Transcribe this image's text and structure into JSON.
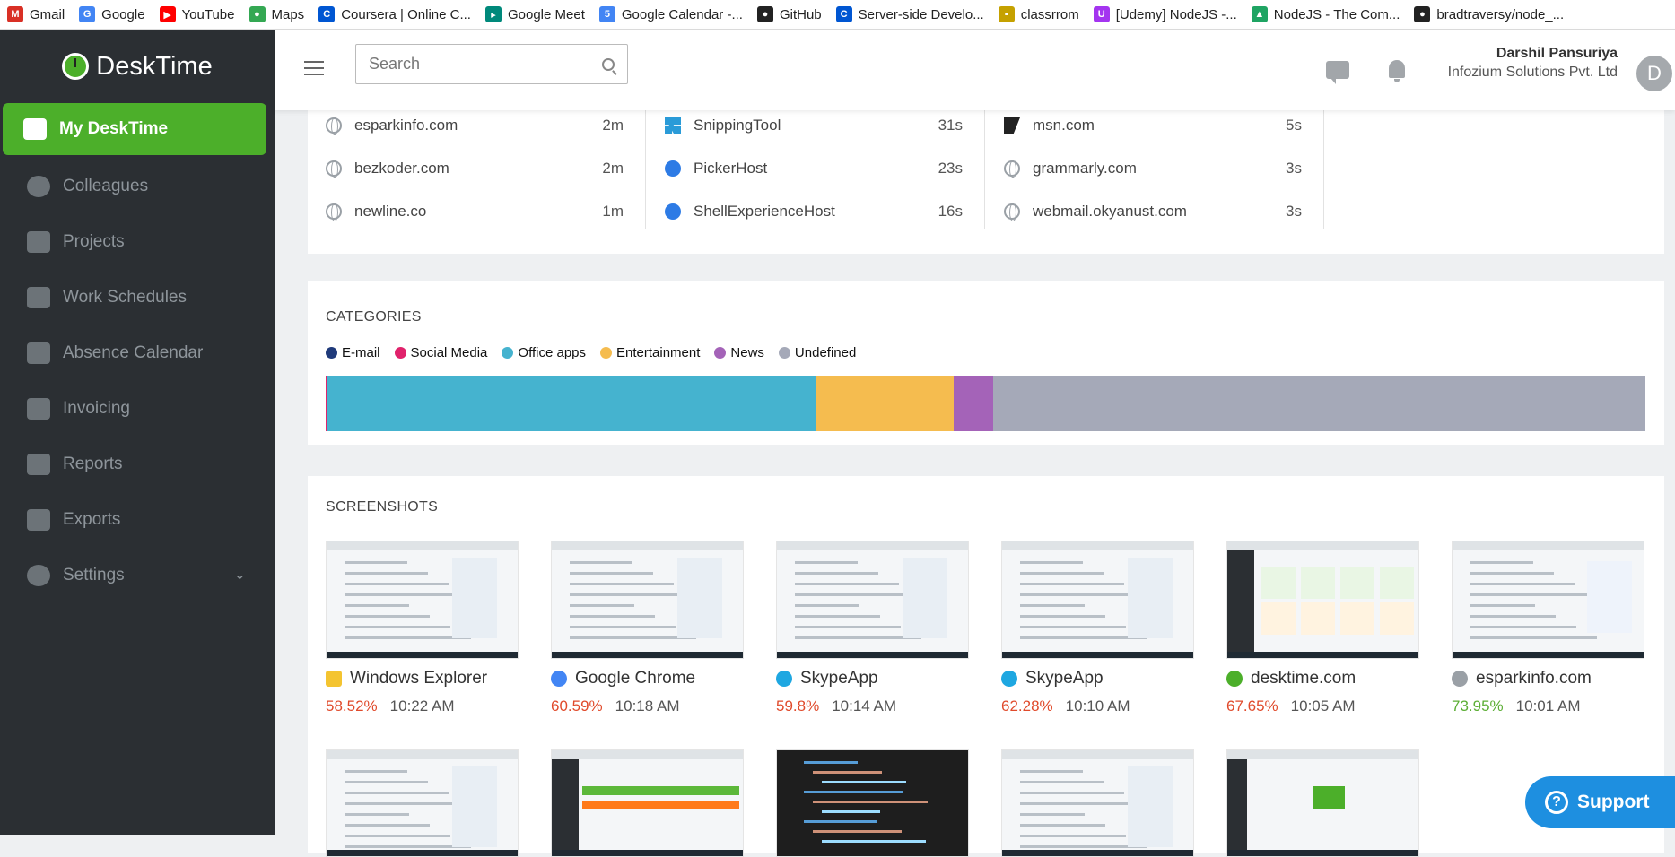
{
  "bookmarks": [
    {
      "label": "Gmail",
      "icon": "gmail-icon",
      "color": "#d93025",
      "glyph": "M"
    },
    {
      "label": "Google",
      "icon": "google-icon",
      "color": "#4285f4",
      "glyph": "G"
    },
    {
      "label": "YouTube",
      "icon": "youtube-icon",
      "color": "#ff0000",
      "glyph": "▶"
    },
    {
      "label": "Maps",
      "icon": "maps-icon",
      "color": "#34a853",
      "glyph": "●"
    },
    {
      "label": "Coursera | Online C...",
      "icon": "coursera-icon",
      "color": "#0056d2",
      "glyph": "C"
    },
    {
      "label": "Google Meet",
      "icon": "meet-icon",
      "color": "#00897b",
      "glyph": "▸"
    },
    {
      "label": "Google Calendar -...",
      "icon": "calendar-icon",
      "color": "#4285f4",
      "glyph": "5"
    },
    {
      "label": "GitHub",
      "icon": "github-icon",
      "color": "#222222",
      "glyph": "●"
    },
    {
      "label": "Server-side Develo...",
      "icon": "coursera-icon",
      "color": "#0056d2",
      "glyph": "C"
    },
    {
      "label": "classrrom",
      "icon": "classroom-icon",
      "color": "#c5a100",
      "glyph": "▪"
    },
    {
      "label": "[Udemy] NodeJS -...",
      "icon": "udemy-icon",
      "color": "#a435f0",
      "glyph": "U"
    },
    {
      "label": "NodeJS - The Com...",
      "icon": "drive-icon",
      "color": "#1fa463",
      "glyph": "▲"
    },
    {
      "label": "bradtraversy/node_...",
      "icon": "github-icon",
      "color": "#222222",
      "glyph": "●"
    }
  ],
  "sidebar": {
    "brand": "DeskTime",
    "items": [
      {
        "label": "My DeskTime",
        "icon": "monitor-icon",
        "active": true
      },
      {
        "label": "Colleagues",
        "icon": "user-icon"
      },
      {
        "label": "Projects",
        "icon": "inbox-icon"
      },
      {
        "label": "Work Schedules",
        "icon": "briefcase-icon"
      },
      {
        "label": "Absence Calendar",
        "icon": "calendar-icon"
      },
      {
        "label": "Invoicing",
        "icon": "invoice-icon"
      },
      {
        "label": "Reports",
        "icon": "pie-chart-icon"
      },
      {
        "label": "Exports",
        "icon": "exports-icon"
      },
      {
        "label": "Settings",
        "icon": "gear-icon",
        "chevron": "⌄"
      }
    ]
  },
  "header": {
    "search_placeholder": "Search",
    "user_name": "Darshil Pansuriya",
    "company": "Infozium Solutions Pvt. Ltd",
    "avatar_letter": "D"
  },
  "apps": [
    [
      {
        "name": "esparkinfo.com",
        "time": "2m",
        "icon": "globe"
      },
      {
        "name": "bezkoder.com",
        "time": "2m",
        "icon": "globe"
      },
      {
        "name": "newline.co",
        "time": "1m",
        "icon": "globe"
      }
    ],
    [
      {
        "name": "SnippingTool",
        "time": "31s",
        "icon": "win"
      },
      {
        "name": "PickerHost",
        "time": "23s",
        "icon": "blue"
      },
      {
        "name": "ShellExperienceHost",
        "time": "16s",
        "icon": "blue"
      }
    ],
    [
      {
        "name": "msn.com",
        "time": "5s",
        "icon": "msn"
      },
      {
        "name": "grammarly.com",
        "time": "3s",
        "icon": "globe"
      },
      {
        "name": "webmail.okyanust.com",
        "time": "3s",
        "icon": "globe"
      }
    ]
  ],
  "categories": {
    "title": "CATEGORIES",
    "legend": [
      {
        "label": "E-mail",
        "color": "#1f3a7a"
      },
      {
        "label": "Social Media",
        "color": "#e0226b"
      },
      {
        "label": "Office apps",
        "color": "#45b3cf"
      },
      {
        "label": "Entertainment",
        "color": "#f5bc4f"
      },
      {
        "label": "News",
        "color": "#a463b8"
      },
      {
        "label": "Undefined",
        "color": "#a5a9b8"
      }
    ],
    "shares": [
      {
        "color": "#e0226b",
        "pct": 0.13
      },
      {
        "color": "#45b3cf",
        "pct": 37.03
      },
      {
        "color": "#f5bc4f",
        "pct": 10.42
      },
      {
        "color": "#a463b8",
        "pct": 3.0
      },
      {
        "color": "#a5a9b8",
        "pct": 49.42
      }
    ]
  },
  "screenshots": {
    "title": "SCREENSHOTS",
    "items": [
      {
        "app": "Windows Explorer",
        "pct": "58.52%",
        "time": "10:22 AM",
        "pct_color": "#e04a2b",
        "icon": "folder-icon",
        "icon_color": "#f4c430"
      },
      {
        "app": "Google Chrome",
        "pct": "60.59%",
        "time": "10:18 AM",
        "pct_color": "#e04a2b",
        "icon": "chrome-icon",
        "icon_color": "#4285f4"
      },
      {
        "app": "SkypeApp",
        "pct": "59.8%",
        "time": "10:14 AM",
        "pct_color": "#e04a2b",
        "icon": "skype-icon",
        "icon_color": "#1ea7e1"
      },
      {
        "app": "SkypeApp",
        "pct": "62.28%",
        "time": "10:10 AM",
        "pct_color": "#e04a2b",
        "icon": "skype-icon",
        "icon_color": "#1ea7e1"
      },
      {
        "app": "desktime.com",
        "pct": "67.65%",
        "time": "10:05 AM",
        "pct_color": "#e04a2b",
        "icon": "desktime-icon",
        "icon_color": "#4caf2a"
      },
      {
        "app": "esparkinfo.com",
        "pct": "73.95%",
        "time": "10:01 AM",
        "pct_color": "#5cae35",
        "icon": "globe-icon",
        "icon_color": "#9aa0a6"
      }
    ],
    "thumb_themes": [
      "light",
      "light",
      "light",
      "light",
      "green",
      "white"
    ],
    "row2_themes": [
      "light",
      "green-bars",
      "dark",
      "light",
      "desktime-app"
    ]
  },
  "support_label": "Support"
}
